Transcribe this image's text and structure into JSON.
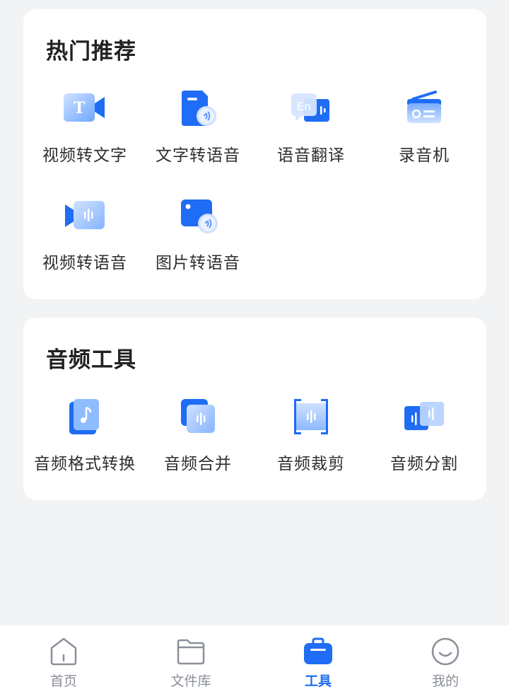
{
  "colors": {
    "primary": "#1f6cf5",
    "background": "#f2f3f5",
    "card": "#ffffff",
    "inactive": "#8a8f99"
  },
  "hot": {
    "title": "热门推荐",
    "items": [
      {
        "label": "视频转文字",
        "icon": "video-to-text-icon"
      },
      {
        "label": "文字转语音",
        "icon": "text-to-speech-icon"
      },
      {
        "label": "语音翻译",
        "icon": "voice-translate-icon"
      },
      {
        "label": "录音机",
        "icon": "recorder-icon"
      },
      {
        "label": "视频转语音",
        "icon": "video-to-audio-icon"
      },
      {
        "label": "图片转语音",
        "icon": "image-to-speech-icon"
      }
    ]
  },
  "audio": {
    "title": "音频工具",
    "items": [
      {
        "label": "音频格式转换",
        "icon": "audio-format-convert-icon"
      },
      {
        "label": "音频合并",
        "icon": "audio-merge-icon"
      },
      {
        "label": "音频裁剪",
        "icon": "audio-trim-icon"
      },
      {
        "label": "音频分割",
        "icon": "audio-split-icon"
      }
    ]
  },
  "tabbar": {
    "active": "工具",
    "tabs": [
      {
        "label": "首页",
        "icon": "home-icon"
      },
      {
        "label": "文件库",
        "icon": "folder-icon"
      },
      {
        "label": "工具",
        "icon": "toolbox-icon"
      },
      {
        "label": "我的",
        "icon": "profile-icon"
      }
    ]
  }
}
